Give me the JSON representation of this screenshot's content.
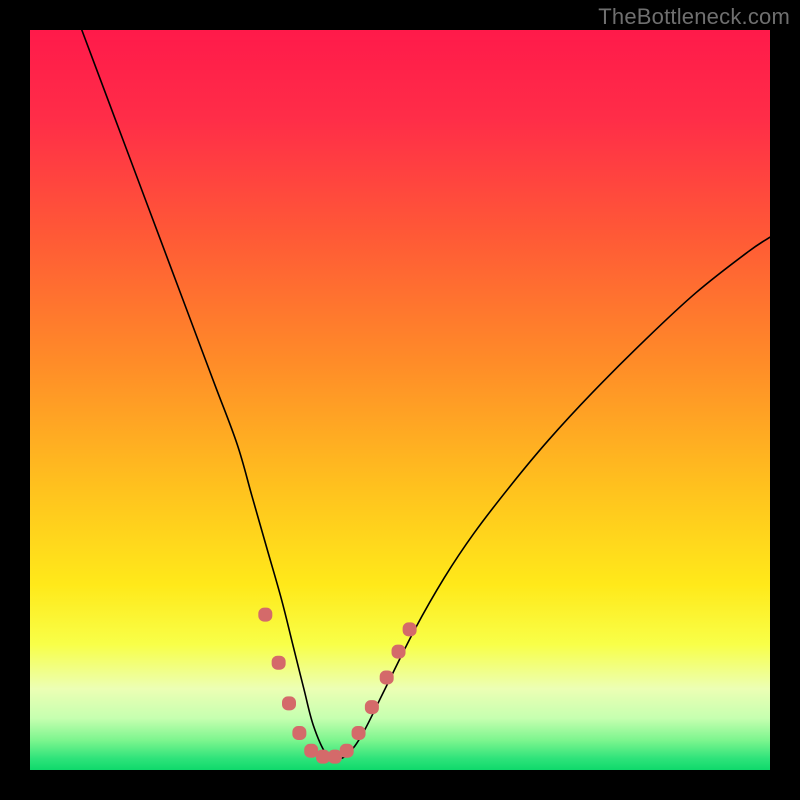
{
  "watermark": "TheBottleneck.com",
  "gradient_stops": [
    {
      "offset": 0.0,
      "color": "#ff1a4a"
    },
    {
      "offset": 0.12,
      "color": "#ff2d48"
    },
    {
      "offset": 0.28,
      "color": "#ff5a36"
    },
    {
      "offset": 0.45,
      "color": "#ff8c28"
    },
    {
      "offset": 0.62,
      "color": "#ffc21e"
    },
    {
      "offset": 0.75,
      "color": "#ffe91a"
    },
    {
      "offset": 0.83,
      "color": "#f8ff48"
    },
    {
      "offset": 0.89,
      "color": "#ecffb4"
    },
    {
      "offset": 0.93,
      "color": "#c6ffb0"
    },
    {
      "offset": 0.96,
      "color": "#7cf58e"
    },
    {
      "offset": 0.985,
      "color": "#2de37a"
    },
    {
      "offset": 1.0,
      "color": "#0fd96b"
    }
  ],
  "chart_data": {
    "type": "line",
    "title": "",
    "xlabel": "",
    "ylabel": "",
    "xlim": [
      0,
      100
    ],
    "ylim": [
      0,
      100
    ],
    "grid": false,
    "series": [
      {
        "name": "bottleneck-curve",
        "color": "#000000",
        "width": 1.6,
        "x": [
          7,
          10,
          13,
          16,
          19,
          22,
          25,
          28,
          30,
          32,
          34,
          35.5,
          37,
          38.3,
          40,
          41.5,
          43,
          45,
          48,
          52,
          56,
          60,
          65,
          70,
          76,
          83,
          90,
          97,
          100
        ],
        "y": [
          100,
          92,
          84,
          76,
          68,
          60,
          52,
          44,
          37,
          30,
          23,
          17,
          11,
          6,
          2.2,
          1.5,
          2.2,
          5,
          11,
          19,
          26,
          32,
          38.5,
          44.5,
          51,
          58,
          64.5,
          70,
          72
        ]
      },
      {
        "name": "markers-near-min",
        "color": "#d46a6a",
        "shape": "rounded-square",
        "size": 14,
        "x": [
          31.8,
          33.6,
          35.0,
          36.4,
          38.0,
          39.6,
          41.2,
          42.8,
          44.4,
          46.2,
          48.2,
          49.8,
          51.3
        ],
        "y": [
          21.0,
          14.5,
          9.0,
          5.0,
          2.6,
          1.8,
          1.8,
          2.6,
          5.0,
          8.5,
          12.5,
          16.0,
          19.0
        ]
      }
    ]
  }
}
